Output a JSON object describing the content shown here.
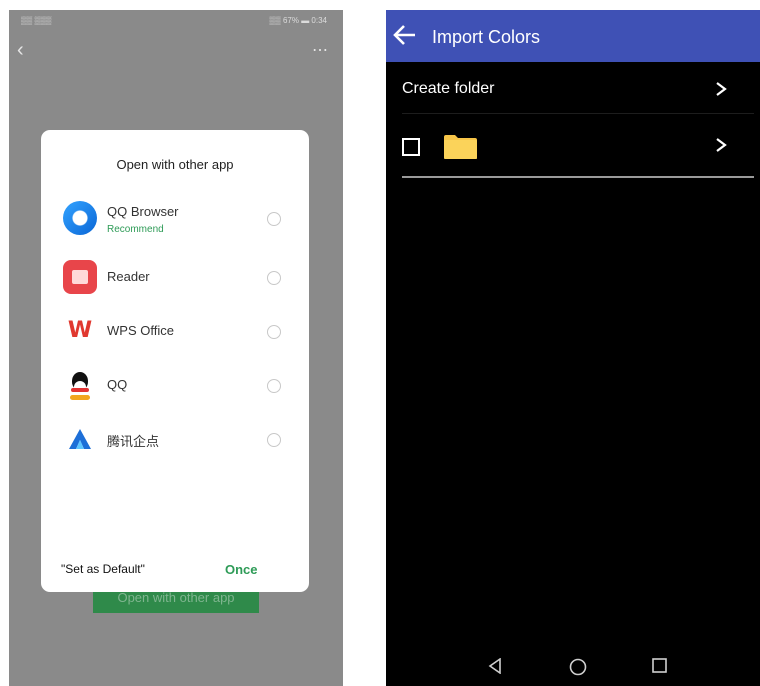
{
  "left_screen": {
    "status_bar": {
      "left_text": "▒▒ ▒▒▒",
      "right_text": "▒▒ 67% ▬ 0:34"
    },
    "back_icon": "chevron-left-icon",
    "more_icon": "more-icon",
    "behind_button_label": "Open with other app",
    "dialog": {
      "title": "Open with other app",
      "apps": [
        {
          "name": "QQ Browser",
          "subtitle": "Recommend",
          "icon": "qq-browser-icon"
        },
        {
          "name": "Reader",
          "icon": "reader-icon"
        },
        {
          "name": "WPS Office",
          "icon": "wps-office-icon"
        },
        {
          "name": "QQ",
          "icon": "qq-icon"
        },
        {
          "name": "腾讯企点",
          "icon": "tencent-qidian-icon"
        }
      ],
      "set_default_label": "\"Set as Default\"",
      "once_label": "Once"
    }
  },
  "right_screen": {
    "app_bar": {
      "title": "Import Colors",
      "back_icon": "arrow-left-icon",
      "color": "#3f51b5"
    },
    "rows": [
      {
        "label": "Create folder",
        "chevron": ">"
      },
      {
        "label": "",
        "icon": "folder-icon",
        "folder_color": "#f7c548",
        "chevron": ">"
      }
    ],
    "nav_bar": {
      "icons": [
        "back-triangle-icon",
        "home-circle-icon",
        "recents-square-icon"
      ]
    }
  }
}
